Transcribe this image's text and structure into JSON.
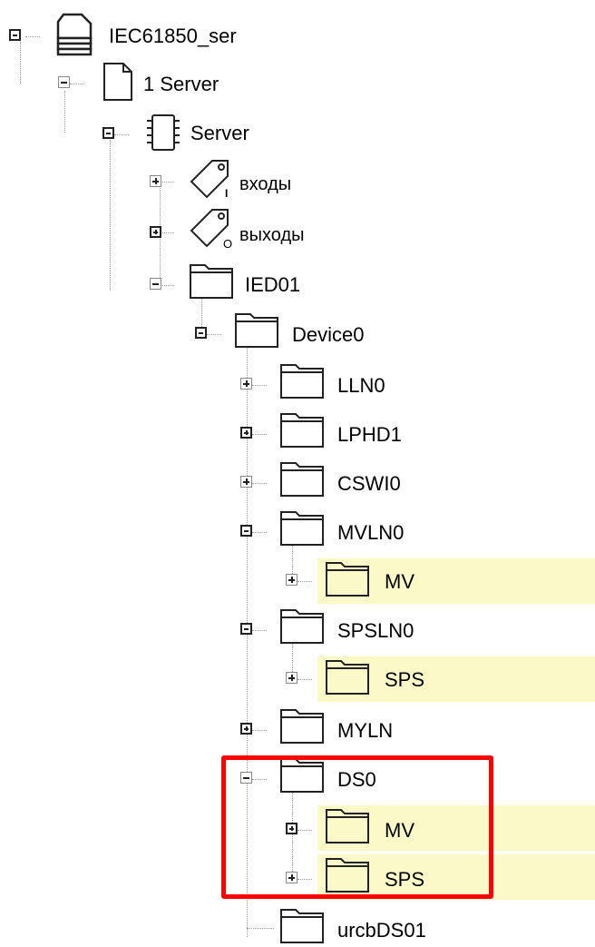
{
  "tree": {
    "root": "IEC61850_ser",
    "server_file": "1 Server",
    "server": "Server",
    "inputs": "входы",
    "outputs": "выходы",
    "ied": "IED01",
    "device": "Device0",
    "nodes": [
      "LLN0",
      "LPHD1",
      "CSWI0",
      "MVLN0",
      "MV",
      "SPSLN0",
      "SPS",
      "MYLN",
      "DS0",
      "MV",
      "SPS",
      "urcbDS01"
    ],
    "input_tag_glyph": "I",
    "output_tag_glyph": "O"
  },
  "colors": {
    "highlight": "#fbf9c8",
    "selection_frame": "#ff0000"
  },
  "icons": {
    "root": "database-icon",
    "file": "file-icon",
    "server": "chip-icon",
    "tag": "tag-icon",
    "folder": "folder-icon"
  }
}
